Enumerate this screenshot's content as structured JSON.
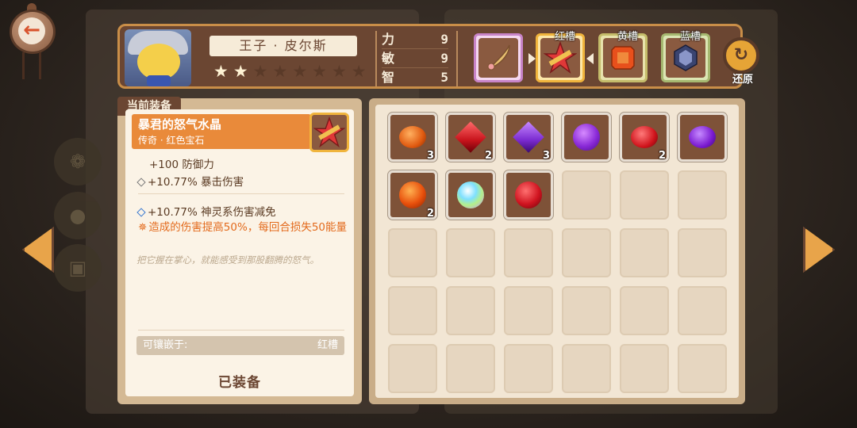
{
  "header": {
    "hero_name": "王子 · 皮尔斯",
    "stars": {
      "filled": 2,
      "total": 8
    },
    "stats": [
      {
        "label": "力",
        "value": "9"
      },
      {
        "label": "敏",
        "value": "9"
      },
      {
        "label": "智",
        "value": "5"
      }
    ],
    "slots": {
      "red": "红槽",
      "yellow": "黄槽",
      "blue": "蓝槽"
    },
    "restore_label": "还原"
  },
  "detail": {
    "tab_label": "当前装备",
    "item_name": "暴君的怒气水晶",
    "item_type": "传奇 · 红色宝石",
    "stat1": "+100  防御力",
    "stat2": "+10.77%  暴击伤害",
    "stat3": "+10.77%  神灵系伤害减免",
    "effect": "造成的伤害提高50%，每回合损失50能量",
    "flavor": "把它握在掌心，就能感受到那股翻腾的怒气。",
    "socket_label": "可镶嵌于:",
    "socket_value": "红槽",
    "equipped_label": "已装备"
  },
  "inventory": {
    "items": [
      {
        "gem": "orange-round-gem",
        "count": "3"
      },
      {
        "gem": "red-diamond-gem",
        "count": "2"
      },
      {
        "gem": "purple-diamond-gem",
        "count": "3"
      },
      {
        "gem": "purple-swirl-gem",
        "count": ""
      },
      {
        "gem": "red-oval-gem",
        "count": "2"
      },
      {
        "gem": "purple-oval-gem",
        "count": ""
      },
      {
        "gem": "orange-faceted-gem",
        "count": "2"
      },
      {
        "gem": "rainbow-orb-gem",
        "count": ""
      },
      {
        "gem": "red-faceted-gem",
        "count": ""
      }
    ],
    "empty_cells": 21
  },
  "colors": {
    "accent_orange": "#e98a3a",
    "header_brown": "#6b4632",
    "gold_border": "#f0b43c"
  }
}
